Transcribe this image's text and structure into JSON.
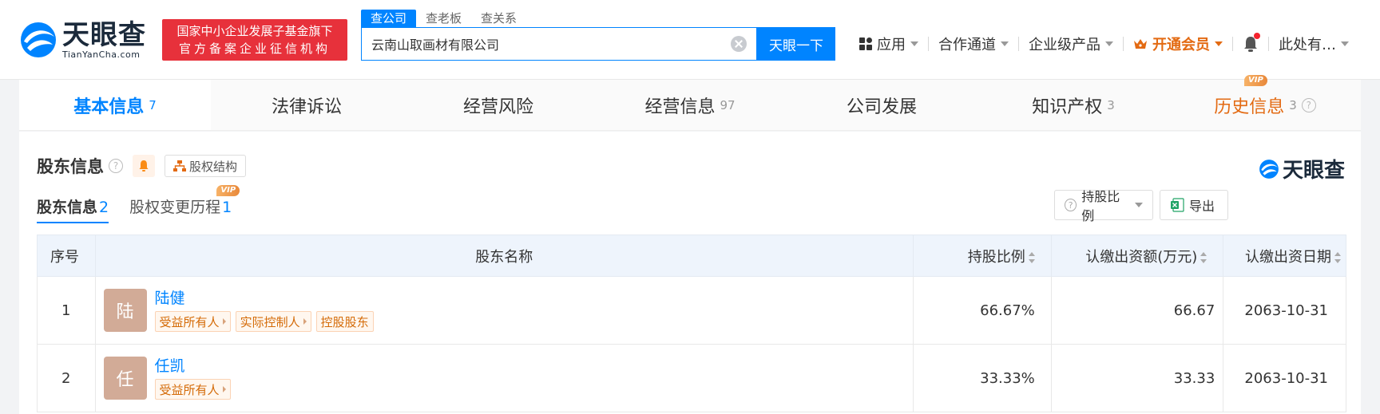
{
  "brand": {
    "name_cn": "天眼查",
    "name_en": "TianYanCha.com",
    "accent": "#0084ff"
  },
  "gov_badge": {
    "line1": "国家中小企业发展子基金旗下",
    "line2": "官方备案企业征信机构"
  },
  "search": {
    "tabs": [
      "查公司",
      "查老板",
      "查关系"
    ],
    "value": "云南山取画材有限公司",
    "button": "天眼一下"
  },
  "nav": {
    "apps": "应用",
    "channel": "合作通道",
    "enterprise": "企业级产品",
    "vip": "开通会员",
    "user": "此处有…"
  },
  "main_tabs": [
    {
      "label": "基本信息",
      "count": "7"
    },
    {
      "label": "法律诉讼",
      "count": ""
    },
    {
      "label": "经营风险",
      "count": ""
    },
    {
      "label": "经营信息",
      "count": "97"
    },
    {
      "label": "公司发展",
      "count": ""
    },
    {
      "label": "知识产权",
      "count": "3"
    },
    {
      "label": "历史信息",
      "count": "3"
    }
  ],
  "vip_label": "VIP",
  "section": {
    "title": "股东信息",
    "struct_button": "股权结构",
    "brand_small": "天眼查",
    "sub_tabs": [
      {
        "label": "股东信息",
        "count": "2"
      },
      {
        "label": "股权变更历程",
        "count": "1"
      }
    ],
    "ratio_button": "持股比例",
    "export_button": "导出"
  },
  "table": {
    "headers": [
      "序号",
      "股东名称",
      "持股比例",
      "认缴出资额(万元)",
      "认缴出资日期"
    ],
    "rows": [
      {
        "index": "1",
        "avatar": "陆",
        "name": "陆健",
        "tags": [
          "受益所有人",
          "实际控制人",
          "控股股东"
        ],
        "ratio": "66.67%",
        "amount": "66.67",
        "date": "2063-10-31"
      },
      {
        "index": "2",
        "avatar": "任",
        "name": "任凯",
        "tags": [
          "受益所有人"
        ],
        "ratio": "33.33%",
        "amount": "33.33",
        "date": "2063-10-31"
      }
    ]
  }
}
